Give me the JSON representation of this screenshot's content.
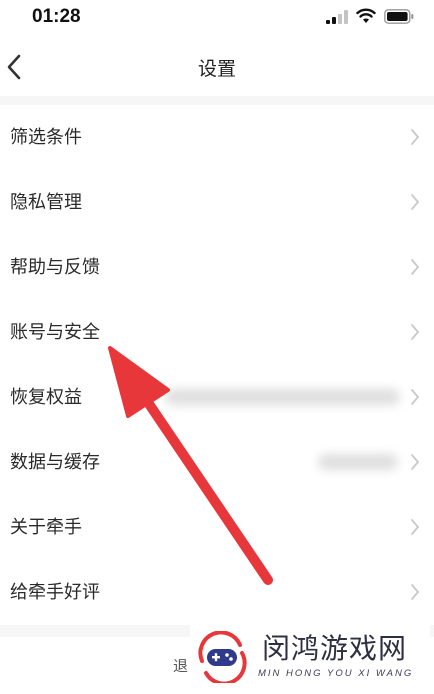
{
  "status_bar": {
    "time": "01:28",
    "icons": [
      "signal-icon",
      "wifi-icon",
      "battery-icon"
    ]
  },
  "nav": {
    "title": "设置",
    "back_icon": "chevron-left-icon"
  },
  "settings": {
    "items": [
      {
        "label": "筛选条件"
      },
      {
        "label": "隐私管理"
      },
      {
        "label": "帮助与反馈"
      },
      {
        "label": "账号与安全"
      },
      {
        "label": "恢复权益"
      },
      {
        "label": "数据与缓存"
      },
      {
        "label": "关于牵手"
      },
      {
        "label": "给牵手好评"
      }
    ]
  },
  "annotation": {
    "type": "arrow",
    "color": "#e8373b",
    "points_to": "账号与安全"
  },
  "bottom": {
    "partial_text": "退"
  },
  "watermark": {
    "text_cn": "闵鸿游戏网",
    "text_en": "MIN HONG YOU XI WANG",
    "logo_icon": "gamepad-logo-icon"
  },
  "colors": {
    "background": "#ffffff",
    "divider_gap": "#f6f6f6",
    "text": "#2a2a2a",
    "chevron": "#c8c8c8",
    "arrow": "#e8373b"
  }
}
